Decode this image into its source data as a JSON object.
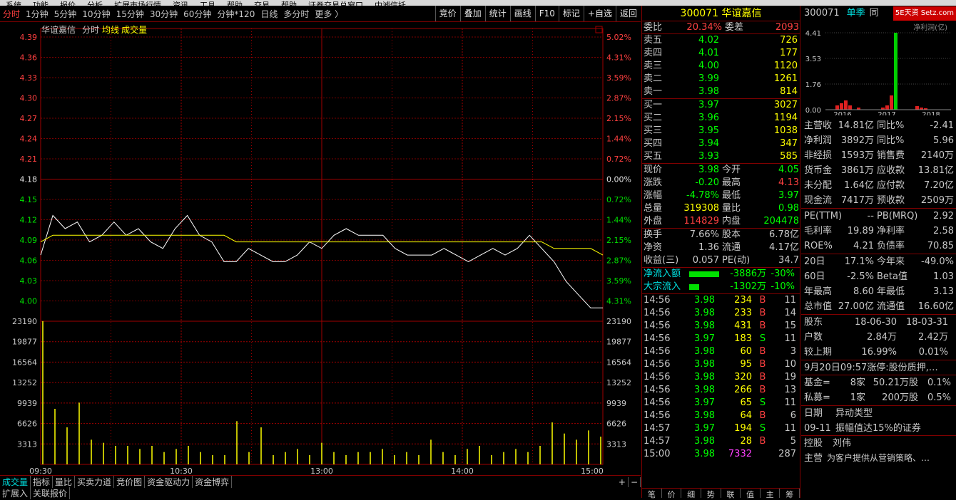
{
  "menubar": [
    "系统",
    "功能",
    "报价",
    "分析",
    "扩展市场行情",
    "资讯",
    "工具",
    "帮助",
    "交易",
    "帮助",
    "证券交易总窗口",
    "中诚信托"
  ],
  "toolbar": {
    "periods": [
      "分时",
      "1分钟",
      "5分钟",
      "10分钟",
      "15分钟",
      "30分钟",
      "60分钟",
      "分钟*120",
      "日线",
      "多分时",
      "更多 〉"
    ],
    "right": [
      "竞价",
      "叠加",
      "统计",
      "画线",
      "F10",
      "标记",
      "+自选",
      "返回"
    ]
  },
  "chart": {
    "name": "华谊嘉信",
    "mode": "分时",
    "ma": "均线",
    "vol": "成交量",
    "price_ticks": [
      "4.39",
      "4.36",
      "4.33",
      "4.30",
      "4.27",
      "4.24",
      "4.21",
      "4.18",
      "4.15",
      "4.12",
      "4.09",
      "4.06",
      "4.03",
      "4.00"
    ],
    "pct_ticks": [
      "5.02%",
      "4.31%",
      "3.59%",
      "2.87%",
      "2.15%",
      "1.44%",
      "0.72%",
      "0.00%",
      "0.72%",
      "1.44%",
      "2.15%",
      "2.87%",
      "3.59%",
      "4.31%"
    ],
    "vol_ticks": [
      "23190",
      "19877",
      "16564",
      "13252",
      "9939",
      "6626",
      "3313"
    ],
    "time_ticks": [
      "09:30",
      "10:30",
      "13:00",
      "14:00",
      "15:00"
    ]
  },
  "chart_data": {
    "type": "line",
    "x": [
      "09:30",
      "10:30",
      "13:00",
      "14:00",
      "15:00"
    ],
    "series": [
      {
        "values": [
          4.06,
          4.12,
          4.1,
          4.11,
          4.08,
          4.09,
          4.11,
          4.09,
          4.1,
          4.08,
          4.07,
          4.1,
          4.12,
          4.09,
          4.08,
          4.05,
          4.05,
          4.07,
          4.06,
          4.05,
          4.05,
          4.06,
          4.08,
          4.07,
          4.09,
          4.1,
          4.09,
          4.09,
          4.09,
          4.07,
          4.06,
          4.06,
          4.06,
          4.07,
          4.06,
          4.05,
          4.06,
          4.07,
          4.06,
          4.07,
          4.09,
          4.07,
          4.05,
          4.02,
          4.0,
          3.98,
          3.98
        ]
      },
      {
        "values": [
          4.08,
          4.09,
          4.09,
          4.09,
          4.09,
          4.09,
          4.09,
          4.09,
          4.09,
          4.09,
          4.09,
          4.09,
          4.09,
          4.09,
          4.09,
          4.09,
          4.08,
          4.08,
          4.08,
          4.08,
          4.08,
          4.08,
          4.08,
          4.08,
          4.08,
          4.08,
          4.08,
          4.08,
          4.08,
          4.08,
          4.08,
          4.08,
          4.08,
          4.08,
          4.08,
          4.08,
          4.08,
          4.08,
          4.08,
          4.08,
          4.08,
          4.08,
          4.07,
          4.07,
          4.07,
          4.07,
          4.06
        ]
      }
    ],
    "volume": [
      23190,
      9000,
      6000,
      10000,
      4000,
      3500,
      3000,
      3000,
      2500,
      3000,
      2000,
      2500,
      3000,
      2000,
      1500,
      1500,
      7000,
      2000,
      6000,
      1500,
      2000,
      2500,
      1500,
      3500,
      2000,
      1500,
      2000,
      2000,
      2500,
      1500,
      2000,
      1500,
      4000,
      2000,
      1500,
      2500,
      3000,
      1500,
      2000,
      2500,
      2000,
      3000,
      6800,
      5000,
      4000,
      5500,
      4500
    ],
    "ylim": [
      3.97,
      4.39
    ]
  },
  "quote": {
    "code": "300071",
    "name": "华谊嘉信",
    "wb_l": "委比",
    "wb": "20.34%",
    "wc_l": "委差",
    "wc": "2093",
    "asks": [
      {
        "l": "卖五",
        "p": "4.02",
        "v": "726"
      },
      {
        "l": "卖四",
        "p": "4.01",
        "v": "177"
      },
      {
        "l": "卖三",
        "p": "4.00",
        "v": "1120"
      },
      {
        "l": "卖二",
        "p": "3.99",
        "v": "1261"
      },
      {
        "l": "卖一",
        "p": "3.98",
        "v": "814"
      }
    ],
    "bids": [
      {
        "l": "买一",
        "p": "3.97",
        "v": "3027"
      },
      {
        "l": "买二",
        "p": "3.96",
        "v": "1194"
      },
      {
        "l": "买三",
        "p": "3.95",
        "v": "1038"
      },
      {
        "l": "买四",
        "p": "3.94",
        "v": "347"
      },
      {
        "l": "买五",
        "p": "3.93",
        "v": "585"
      }
    ],
    "stats": [
      [
        "现价",
        "3.98",
        "今开",
        "4.05"
      ],
      [
        "涨跌",
        "-0.20",
        "最高",
        "4.13"
      ],
      [
        "涨幅",
        "-4.78%",
        "最低",
        "3.97"
      ],
      [
        "总量",
        "319308",
        "量比",
        "0.98"
      ],
      [
        "外盘",
        "114829",
        "内盘",
        "204478"
      ]
    ],
    "stats2": [
      [
        "换手",
        "7.66%",
        "股本",
        "6.78亿"
      ],
      [
        "净资",
        "1.36",
        "流通",
        "4.17亿"
      ],
      [
        "收益(三)",
        "0.057",
        "PE(动)",
        "34.7"
      ]
    ],
    "flow": [
      [
        "净流入额",
        "-3886万",
        "-30%"
      ],
      [
        "大宗流入",
        "-1302万",
        "-10%"
      ]
    ],
    "ticks": [
      [
        "14:56",
        "3.98",
        "234",
        "B",
        "11"
      ],
      [
        "14:56",
        "3.98",
        "233",
        "B",
        "14"
      ],
      [
        "14:56",
        "3.98",
        "431",
        "B",
        "15"
      ],
      [
        "14:56",
        "3.97",
        "183",
        "S",
        "11"
      ],
      [
        "14:56",
        "3.98",
        "60",
        "B",
        "3"
      ],
      [
        "14:56",
        "3.98",
        "95",
        "B",
        "10"
      ],
      [
        "14:56",
        "3.98",
        "320",
        "B",
        "19"
      ],
      [
        "14:56",
        "3.98",
        "266",
        "B",
        "13"
      ],
      [
        "14:56",
        "3.97",
        "65",
        "S",
        "11"
      ],
      [
        "14:56",
        "3.98",
        "64",
        "B",
        "6"
      ],
      [
        "14:57",
        "3.97",
        "194",
        "S",
        "11"
      ],
      [
        "14:57",
        "3.98",
        "28",
        "B",
        "5"
      ],
      [
        "15:00",
        "3.98",
        "7332",
        "",
        "287"
      ]
    ]
  },
  "fund": {
    "code": "300071",
    "tab": "单季",
    "tab2": "同",
    "unit": "净利润(亿)",
    "yticks": [
      "4.41",
      "3.53",
      "1.76",
      "0.00"
    ],
    "years": [
      "2016",
      "2017",
      "2018"
    ],
    "rows": [
      [
        "主营收",
        "14.81亿",
        "同比%",
        "-2.41"
      ],
      [
        "净利润",
        "3892万",
        "同比%",
        "5.96"
      ],
      [
        "非经损",
        "1593万",
        "销售费",
        "2140万"
      ],
      [
        "货币金",
        "3861万",
        "应收款",
        "13.81亿"
      ],
      [
        "未分配",
        "1.64亿",
        "应付款",
        "7.20亿"
      ],
      [
        "现金流",
        "7417万",
        "预收款",
        "2509万"
      ]
    ],
    "rows2": [
      [
        "PE(TTM)",
        "--",
        "PB(MRQ)",
        "2.92"
      ],
      [
        "毛利率",
        "19.89",
        "净利率",
        "2.58"
      ],
      [
        "ROE%",
        "4.21",
        "负债率",
        "70.85"
      ]
    ],
    "rows3": [
      [
        "20日",
        "17.1%",
        "今年来",
        "-49.0%"
      ],
      [
        "60日",
        "-2.5%",
        "Beta值",
        "1.03"
      ],
      [
        "年最高",
        "8.60",
        "年最低",
        "3.13"
      ],
      [
        "总市值",
        "27.00亿",
        "流通值",
        "16.60亿"
      ]
    ],
    "holders": [
      [
        "股东",
        "18-06-30",
        "18-03-31"
      ],
      [
        "户数",
        "2.84万",
        "2.42万"
      ],
      [
        "较上期",
        "16.99%",
        "0.01%"
      ]
    ],
    "news": "9月20日09:57涨停:股份质押,…",
    "inst": [
      [
        "基金=",
        "8家",
        "50.21万股",
        "0.1%"
      ],
      [
        "私募=",
        "1家",
        "200万股",
        "0.5%"
      ]
    ],
    "event_h": [
      "日期",
      "异动类型"
    ],
    "event": [
      "09-11",
      "振幅值达15%的证券"
    ],
    "ctrl": [
      "控股",
      "刘伟"
    ],
    "main": [
      "主营",
      "为客户提供从营销策略、…"
    ]
  },
  "bottom_tabs": [
    "成交量",
    "指标",
    "量比",
    "买卖力道",
    "竞价图",
    "资金驱动力",
    "资金博弈"
  ],
  "bottom_tabs2": [
    "扩展入",
    "关联报价"
  ],
  "q_bottom": [
    "笔",
    "价",
    "细",
    "势",
    "联",
    "值",
    "主",
    "筹"
  ],
  "brand": "5E天资 Setz.com"
}
